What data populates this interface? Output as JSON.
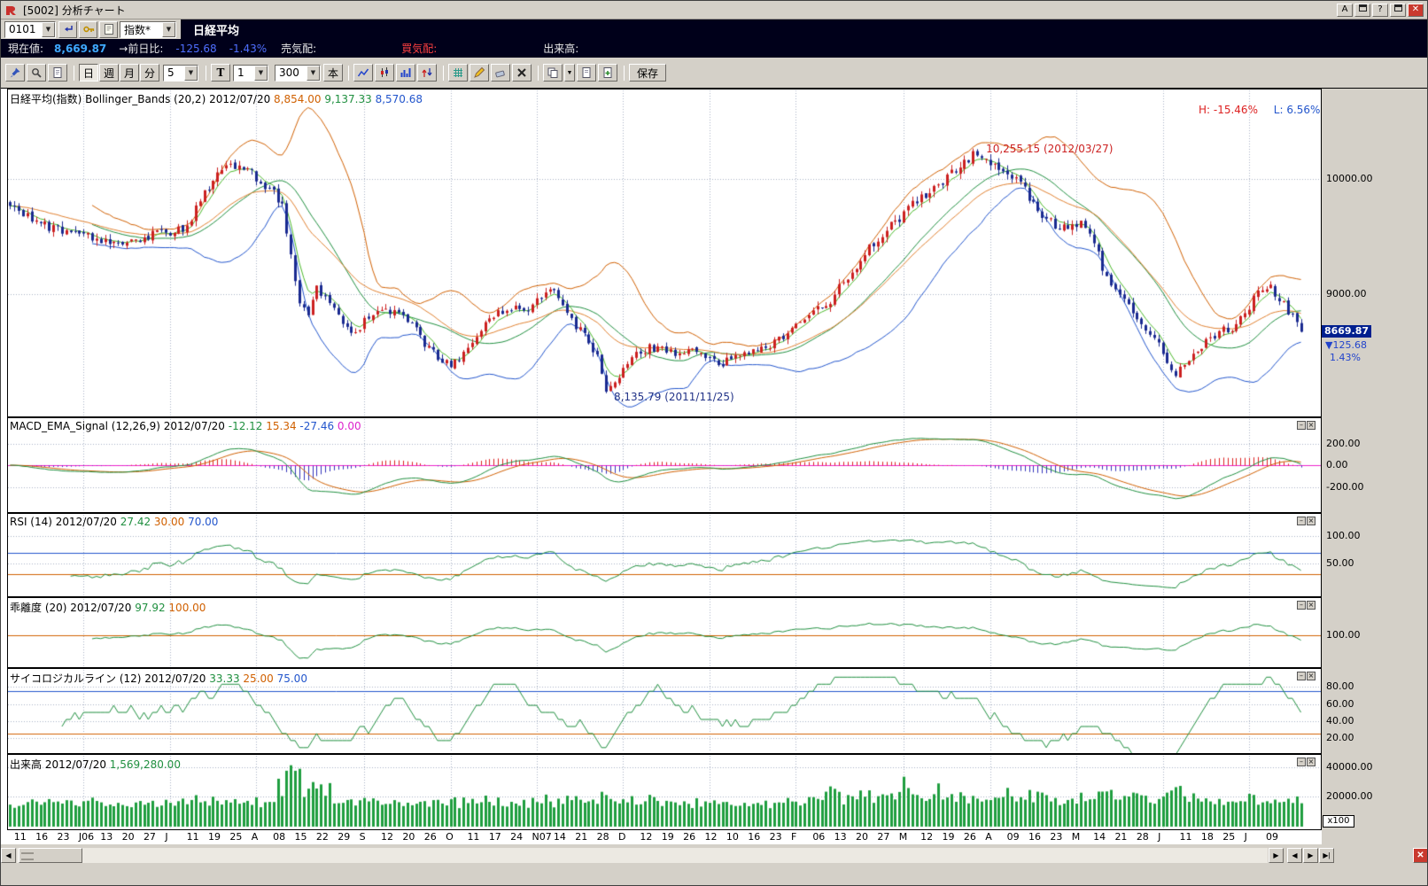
{
  "window": {
    "title": "[5002] 分析チャート",
    "buttons": {
      "font": "A",
      "help": "?",
      "close": "✕"
    }
  },
  "toolbar1": {
    "code_input": "0101",
    "index_select": "指数*",
    "symbol": "日経平均"
  },
  "status": {
    "label_current": "現在値:",
    "current": "8,669.87",
    "label_change": "→前日比:",
    "change": "-125.68",
    "percent": "-1.43%",
    "label_ask": "売気配:",
    "label_bid": "買気配:",
    "label_volume": "出来高:"
  },
  "toolbar2": {
    "period_day": "日",
    "period_week": "週",
    "period_month": "月",
    "period_minute": "分",
    "minutes_value": "5",
    "t_label": "T",
    "t_value": "1",
    "bars_value": "300",
    "bars_unit": "本",
    "save_label": "保存"
  },
  "panel_headers": {
    "price": [
      {
        "t": "日経平均(指数) Bollinger_Bands (20,2) 2012/07/20 ",
        "c": "#000000"
      },
      {
        "t": "8,854.00 ",
        "c": "#d06000"
      },
      {
        "t": "9,137.33 ",
        "c": "#1f8f3f"
      },
      {
        "t": "8,570.68",
        "c": "#2255cc"
      }
    ],
    "macd": [
      {
        "t": "MACD_EMA_Signal (12,26,9) 2012/07/20 ",
        "c": "#000000"
      },
      {
        "t": "-12.12 ",
        "c": "#1f8f3f"
      },
      {
        "t": "15.34 ",
        "c": "#d06000"
      },
      {
        "t": "-27.46 ",
        "c": "#2255cc"
      },
      {
        "t": "0.00",
        "c": "#dd22cc"
      }
    ],
    "rsi": [
      {
        "t": "RSI (14) 2012/07/20 ",
        "c": "#000000"
      },
      {
        "t": "27.42 ",
        "c": "#1f8f3f"
      },
      {
        "t": "30.00 ",
        "c": "#d06000"
      },
      {
        "t": "70.00",
        "c": "#2255cc"
      }
    ],
    "dev": [
      {
        "t": "乖離度 (20) 2012/07/20 ",
        "c": "#000000"
      },
      {
        "t": "97.92 ",
        "c": "#1f8f3f"
      },
      {
        "t": "100.00",
        "c": "#d06000"
      }
    ],
    "psych": [
      {
        "t": "サイコロジカルライン (12) 2012/07/20 ",
        "c": "#000000"
      },
      {
        "t": "33.33 ",
        "c": "#1f8f3f"
      },
      {
        "t": "25.00 ",
        "c": "#d06000"
      },
      {
        "t": "75.00",
        "c": "#2255cc"
      }
    ],
    "volume": [
      {
        "t": "出来高 2012/07/20 ",
        "c": "#000000"
      },
      {
        "t": "1,569,280.00",
        "c": "#1f8f3f"
      }
    ]
  },
  "annotations": {
    "high_label": "H: -15.46%",
    "low_label": "L: 6.56%",
    "peak": "10,255.15 (2012/03/27)",
    "trough": "8,135.79 (2011/11/25)"
  },
  "axis": {
    "badge_value": "8669.87",
    "badge_change": "▼125.68",
    "badge_percent": "1.43%",
    "x100": "x100"
  },
  "colors": {
    "up": "#cc2020",
    "down": "#1a2a90",
    "boll_up": "#d06000",
    "boll_mid": "#1f8f3f",
    "boll_low": "#2255cc",
    "ema5": "#4ab82a",
    "ema25": "#e08030",
    "macd": "#1f8f3f",
    "signal": "#d06000",
    "hist_pos": "#dd2222",
    "hist_neg": "#3333bb",
    "zero": "#ee22cc",
    "rsi": "#1f8f3f",
    "dev": "#1f8f3f",
    "psych": "#1f8f3f",
    "volume": "#1f9e3f",
    "grid": "#a8b0c4"
  },
  "chart_data": {
    "type": "candlestick",
    "title": "日経平均(指数) Bollinger_Bands (20,2)",
    "date": "2012/07/20",
    "bars": 300,
    "seed": 20120720,
    "last_close": 8669.87,
    "last_volume": 15692.8,
    "peak": {
      "bar": 224,
      "price": 10255.15
    },
    "trough": {
      "bar": 138,
      "price": 8135.79
    },
    "price_keypoints": [
      [
        0,
        9800
      ],
      [
        6,
        9620
      ],
      [
        12,
        9550
      ],
      [
        19,
        9480
      ],
      [
        25,
        9450
      ],
      [
        32,
        9500
      ],
      [
        40,
        9560
      ],
      [
        44,
        9780
      ],
      [
        48,
        10090
      ],
      [
        52,
        10110
      ],
      [
        55,
        10080
      ],
      [
        58,
        9990
      ],
      [
        61,
        9870
      ],
      [
        63,
        9740
      ],
      [
        65,
        9350
      ],
      [
        67,
        8950
      ],
      [
        69,
        8820
      ],
      [
        71,
        9060
      ],
      [
        74,
        8940
      ],
      [
        77,
        8700
      ],
      [
        80,
        8660
      ],
      [
        83,
        8800
      ],
      [
        86,
        8890
      ],
      [
        90,
        8830
      ],
      [
        93,
        8760
      ],
      [
        96,
        8550
      ],
      [
        99,
        8460
      ],
      [
        102,
        8380
      ],
      [
        105,
        8470
      ],
      [
        108,
        8630
      ],
      [
        111,
        8810
      ],
      [
        115,
        8870
      ],
      [
        119,
        8850
      ],
      [
        122,
        8930
      ],
      [
        125,
        9040
      ],
      [
        128,
        8900
      ],
      [
        131,
        8720
      ],
      [
        134,
        8600
      ],
      [
        136,
        8450
      ],
      [
        138,
        8160
      ],
      [
        141,
        8260
      ],
      [
        144,
        8440
      ],
      [
        148,
        8540
      ],
      [
        152,
        8510
      ],
      [
        155,
        8470
      ],
      [
        158,
        8500
      ],
      [
        161,
        8460
      ],
      [
        164,
        8390
      ],
      [
        167,
        8430
      ],
      [
        170,
        8470
      ],
      [
        174,
        8510
      ],
      [
        178,
        8590
      ],
      [
        182,
        8770
      ],
      [
        186,
        8830
      ],
      [
        190,
        8950
      ],
      [
        194,
        9150
      ],
      [
        198,
        9350
      ],
      [
        202,
        9520
      ],
      [
        206,
        9660
      ],
      [
        210,
        9810
      ],
      [
        215,
        9960
      ],
      [
        220,
        10080
      ],
      [
        224,
        10230
      ],
      [
        227,
        10150
      ],
      [
        230,
        10090
      ],
      [
        233,
        10010
      ],
      [
        236,
        9840
      ],
      [
        239,
        9690
      ],
      [
        242,
        9580
      ],
      [
        245,
        9560
      ],
      [
        248,
        9600
      ],
      [
        251,
        9420
      ],
      [
        254,
        9150
      ],
      [
        257,
        8980
      ],
      [
        260,
        8860
      ],
      [
        263,
        8700
      ],
      [
        266,
        8560
      ],
      [
        268,
        8430
      ],
      [
        270,
        8310
      ],
      [
        272,
        8400
      ],
      [
        275,
        8510
      ],
      [
        278,
        8610
      ],
      [
        281,
        8690
      ],
      [
        284,
        8720
      ],
      [
        287,
        8900
      ],
      [
        290,
        9050
      ],
      [
        292,
        9080
      ],
      [
        294,
        8950
      ],
      [
        296,
        8850
      ],
      [
        298,
        8760
      ],
      [
        299,
        8669.87
      ]
    ],
    "volume_spikes": [
      [
        66,
        37500
      ],
      [
        124,
        21500
      ],
      [
        190,
        27000
      ],
      [
        207,
        33500
      ],
      [
        215,
        29000
      ],
      [
        231,
        26000
      ],
      [
        253,
        23500
      ],
      [
        270,
        26500
      ],
      [
        287,
        22000
      ]
    ],
    "month_label_indices": [
      3,
      7,
      11,
      16,
      20,
      24,
      28,
      32,
      36,
      41,
      45,
      49,
      53,
      57
    ],
    "xlabels": [
      "11",
      "16",
      "23",
      "J06",
      "13",
      "20",
      "27",
      "J",
      "11",
      "19",
      "25",
      "A",
      "08",
      "15",
      "22",
      "29",
      "S",
      "12",
      "20",
      "26",
      "O",
      "11",
      "17",
      "24",
      "N07",
      "14",
      "21",
      "28",
      "D",
      "12",
      "19",
      "26",
      "12",
      "10",
      "16",
      "23",
      "F",
      "06",
      "13",
      "20",
      "27",
      "M",
      "12",
      "19",
      "26",
      "A",
      "09",
      "16",
      "23",
      "M",
      "14",
      "21",
      "28",
      "J",
      "11",
      "18",
      "25",
      "J",
      "09"
    ],
    "indicator_params": {
      "bollinger": "(20,2)",
      "macd": "(12,26,9)",
      "rsi": "(14)",
      "dev": "(20)",
      "psych": "(12)"
    },
    "panels": {
      "price": {
        "range": [
          7950,
          10650
        ],
        "ticks": [
          {
            "v": 10000,
            "t": "10000.00"
          },
          {
            "v": 9000,
            "t": "9000.00"
          }
        ]
      },
      "macd": {
        "range": [
          -408,
          352
        ],
        "ticks": [
          {
            "v": 200,
            "t": "200.00"
          },
          {
            "v": 0,
            "t": "0.00"
          },
          {
            "v": -200,
            "t": "-200.00"
          }
        ]
      },
      "rsi": {
        "range": [
          -5,
          125
        ],
        "ticks": [
          {
            "v": 100,
            "t": "100.00"
          },
          {
            "v": 50,
            "t": "50.00"
          }
        ],
        "lines": [
          {
            "v": 70,
            "c": "#2255cc"
          },
          {
            "v": 30,
            "c": "#d06000"
          }
        ]
      },
      "dev": {
        "range": [
          88,
          112
        ],
        "ticks": [
          {
            "v": 100,
            "t": "100.00"
          }
        ],
        "lines": [
          {
            "v": 100,
            "c": "#d06000"
          }
        ]
      },
      "psych": {
        "range": [
          5,
          92
        ],
        "ticks": [
          {
            "v": 80,
            "t": "80.00"
          },
          {
            "v": 60,
            "t": "60.00"
          },
          {
            "v": 40,
            "t": "40.00"
          },
          {
            "v": 20,
            "t": "20.00"
          }
        ],
        "lines": [
          {
            "v": 75,
            "c": "#2255cc"
          },
          {
            "v": 25,
            "c": "#d06000"
          }
        ]
      },
      "volume": {
        "range": [
          0,
          44000
        ],
        "ticks": [
          {
            "v": 40000,
            "t": "40000.00"
          },
          {
            "v": 20000,
            "t": "20000.00"
          }
        ]
      }
    }
  }
}
